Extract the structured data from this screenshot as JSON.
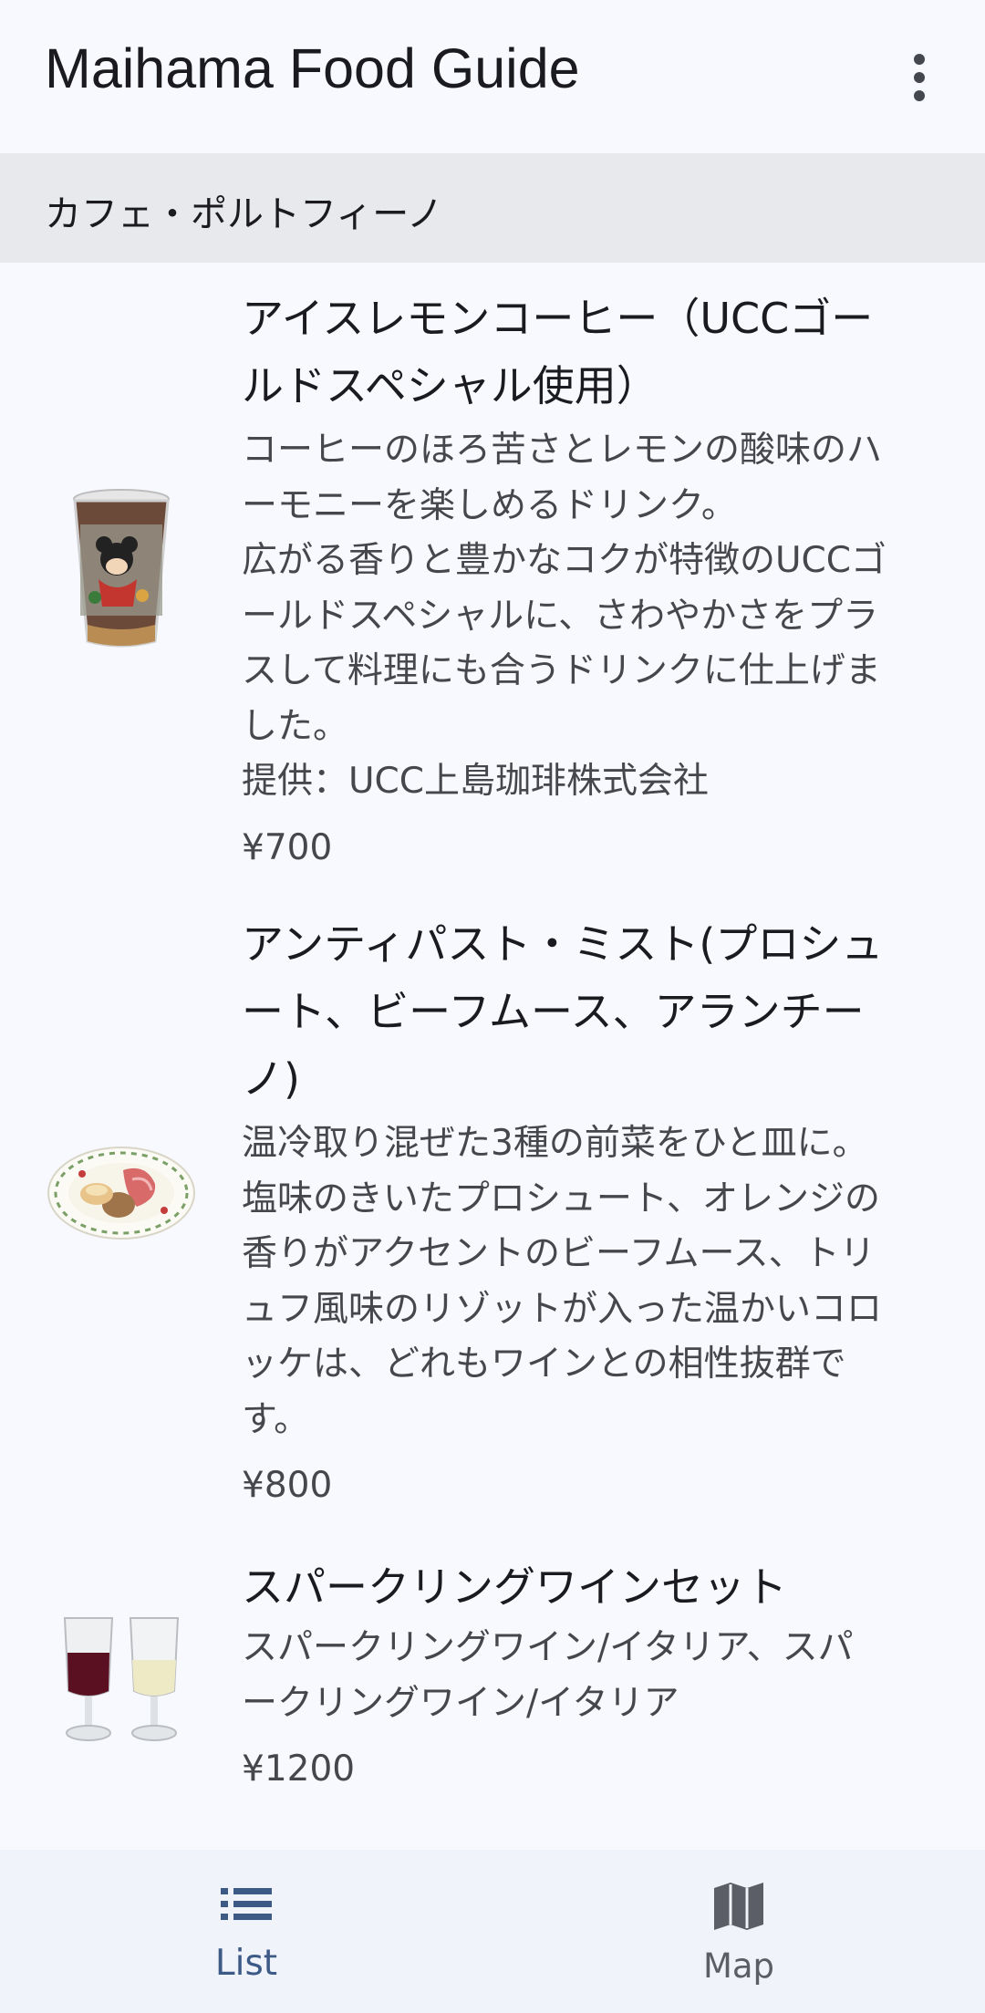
{
  "app_bar": {
    "title": "Maihama Food Guide",
    "menu_icon": "more-vert-icon"
  },
  "section": {
    "title": "カフェ・ポルトフィーノ"
  },
  "items": [
    {
      "name": "アイスレモンコーヒー（UCCゴー\nルドスペシャル使用）",
      "description": "コーヒーのほろ苦さとレモンの酸味のハ\nーモニーを楽しめるドリンク。\n広がる香りと豊かなコクが特徴のUCCゴ\nールドスペシャルに、さわやかさをプラ\nスして料理にも合うドリンクに仕上げま\nした。\n提供：UCC上島珈琲株式会社",
      "price": "¥700",
      "image_icon": "iced-coffee-cup-image"
    },
    {
      "name": "アンティパスト・ミスト(プロシュ\nート、ビーフムース、アランチー\nノ)",
      "description": "温冷取り混ぜた3種の前菜をひと皿に。\n塩味のきいたプロシュート、オレンジの\n香りがアクセントのビーフムース、トリ\nュフ風味のリゾットが入った温かいコロ\nッケは、どれもワインとの相性抜群で\nす。",
      "price": "¥800",
      "image_icon": "antipasto-plate-image"
    },
    {
      "name": "スパークリングワインセット",
      "description": "スパークリングワイン/イタリア、スパ\nークリングワイン/イタリア",
      "price": "¥1200",
      "image_icon": "wine-glasses-image"
    }
  ],
  "bottom_nav": {
    "list_label": "List",
    "list_icon": "list-icon",
    "map_label": "Map",
    "map_icon": "map-icon",
    "active": "List"
  },
  "colors": {
    "background": "#f7f9fe",
    "section_header": "#e8e9ec",
    "nav_active": "#3d5a86",
    "nav_inactive": "#5b5e66"
  }
}
